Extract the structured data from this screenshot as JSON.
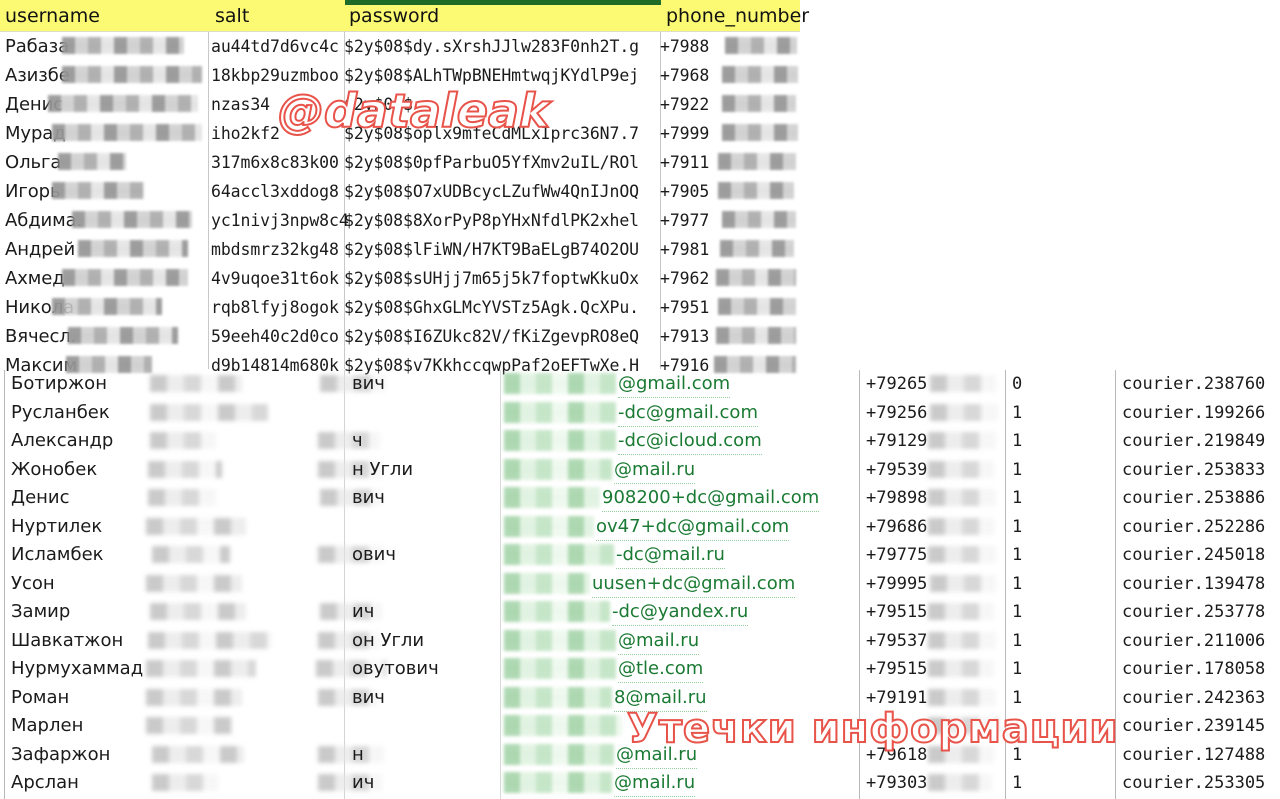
{
  "watermarks": {
    "top": "@dataleak",
    "bottom": "Утечки информации",
    "stroke_color": "#e8534a"
  },
  "top_table": {
    "header_bg": "#fbfa72",
    "selected_column_bar_color": "#1e6b28",
    "columns": [
      "username",
      "salt",
      "password",
      "phone_number"
    ],
    "rows": [
      {
        "username": "Рабаза",
        "salt": "au44td7d6vc4c",
        "password": "$2y$08$dy.sXrshJJlw283F0nh2T.g",
        "phone": "+7988"
      },
      {
        "username": "Азизбе",
        "salt": "18kbp29uzmboo",
        "password": "$2y$08$ALhTWpBNEHmtwqjKYdlP9ej",
        "phone": "+7968"
      },
      {
        "username": "Денис",
        "salt": "nzas34",
        "password": "$2y$08$",
        "phone": "+7922"
      },
      {
        "username": "Мурад",
        "salt": "iho2kf2",
        "password": "$2y$08$oplx9mfeCdMLxIprc36N7.7",
        "phone": "+7999"
      },
      {
        "username": "Ольга",
        "salt": "317m6x8c83k00",
        "password": "$2y$08$0pfParbuO5YfXmv2uIL/ROl",
        "phone": "+7911"
      },
      {
        "username": "Игорь",
        "salt": "64accl3xddog8",
        "password": "$2y$08$O7xUDBcycLZufWw4QnIJnOQ",
        "phone": "+7905"
      },
      {
        "username": "Абдима.",
        "salt": "yc1nivj3npw8c4",
        "password": "$2y$08$8XorPyP8pYHxNfdlPK2xhel",
        "phone": "+7977"
      },
      {
        "username": "Андрей",
        "salt": "mbdsmrz32kg48",
        "password": "$2y$08$lFiWN/H7KT9BaELgB74O2OU",
        "phone": "+7981"
      },
      {
        "username": "Ахмед",
        "salt": "4v9uqoe31t6ok",
        "password": "$2y$08$sUHjj7m65j5k7foptwKkuOx",
        "phone": "+7962"
      },
      {
        "username": "Никола",
        "salt": "rqb8lfyj8ogok",
        "password": "$2y$08$GhxGLMcYVSTz5Agk.QcXPu.",
        "phone": "+7951"
      },
      {
        "username": "Вячесл.",
        "salt": "59eeh40c2d0co",
        "password": "$2y$08$I6ZUkc82V/fKiZgevpRO8eQ",
        "phone": "+7913"
      },
      {
        "username": "Максим",
        "salt": "d9b14814m680k",
        "password": "$2y$08$v7KkhccqwpPaf2oEFTwXe.H",
        "phone": "+7916"
      }
    ]
  },
  "bottom_table": {
    "email_highlight_color": "#1a7a33",
    "rows": [
      {
        "first_name": "Ботиржон",
        "patronymic_suffix": "вич",
        "email": "@gmail.com",
        "phone": "+79265",
        "flag": "0",
        "courier_id": "courier.238760"
      },
      {
        "first_name": "Русланбек",
        "patronymic_suffix": "",
        "email": "-dc@gmail.com",
        "phone": "+79256",
        "flag": "1",
        "courier_id": "courier.199266"
      },
      {
        "first_name": "Александр",
        "patronymic_suffix": "ч",
        "email": "-dc@icloud.com",
        "phone": "+79129",
        "flag": "1",
        "courier_id": "courier.219849"
      },
      {
        "first_name": "Жонобек",
        "patronymic_suffix": "н Угли",
        "email": "@mail.ru",
        "phone": "+79539",
        "flag": "1",
        "courier_id": "courier.253833"
      },
      {
        "first_name": "Денис",
        "patronymic_suffix": "вич",
        "email": "908200+dc@gmail.com",
        "phone": "+79898",
        "flag": "1",
        "courier_id": "courier.253886"
      },
      {
        "first_name": "Нуртилек",
        "patronymic_suffix": "",
        "email": "ov47+dc@gmail.com",
        "phone": "+79686",
        "flag": "1",
        "courier_id": "courier.252286"
      },
      {
        "first_name": "Исламбек",
        "patronymic_suffix": "ович",
        "email": "-dc@mail.ru",
        "phone": "+79775",
        "flag": "1",
        "courier_id": "courier.245018"
      },
      {
        "first_name": "Усон",
        "patronymic_suffix": "",
        "email": "uusen+dc@gmail.com",
        "phone": "+79995",
        "flag": "1",
        "courier_id": "courier.139478"
      },
      {
        "first_name": "Замир",
        "patronymic_suffix": "ич",
        "email": "-dc@yandex.ru",
        "phone": "+79515",
        "flag": "1",
        "courier_id": "courier.253778"
      },
      {
        "first_name": "Шавкатжон",
        "patronymic_suffix": "он Угли",
        "email": "@mail.ru",
        "phone": "+79537",
        "flag": "1",
        "courier_id": "courier.211006"
      },
      {
        "first_name": "Нурмухаммад",
        "patronymic_suffix": "овутович",
        "email": "@tle.com",
        "phone": "+79515",
        "flag": "1",
        "courier_id": "courier.178058"
      },
      {
        "first_name": "Роман",
        "patronymic_suffix": "вич",
        "email": "8@mail.ru",
        "phone": "+79191",
        "flag": "1",
        "courier_id": "courier.242363"
      },
      {
        "first_name": "Марлен",
        "patronymic_suffix": "",
        "email": "",
        "phone": "",
        "flag": "",
        "courier_id": "courier.239145"
      },
      {
        "first_name": "Зафаржон",
        "patronymic_suffix": "н",
        "email": "@mail.ru",
        "phone": "+79618",
        "flag": "1",
        "courier_id": "courier.127488"
      },
      {
        "first_name": "Арслан",
        "patronymic_suffix": "ич",
        "email": "@mail.ru",
        "phone": "+79303",
        "flag": "1",
        "courier_id": "courier.253305"
      }
    ]
  }
}
